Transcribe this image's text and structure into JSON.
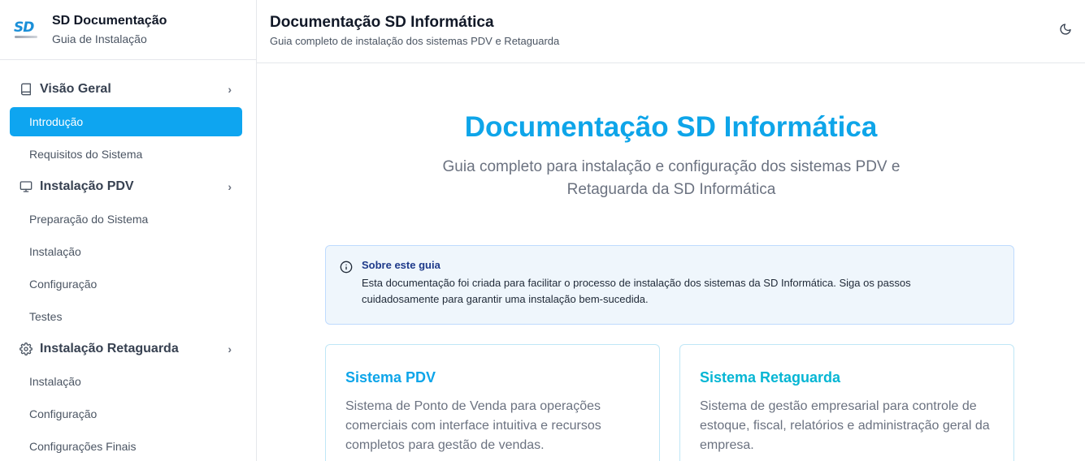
{
  "brand": {
    "logo_text": "SD",
    "title": "SD Documentação",
    "subtitle": "Guia de Instalação"
  },
  "sidebar": {
    "sections": [
      {
        "label": "Visão Geral",
        "icon": "book-icon",
        "items": [
          "Introdução",
          "Requisitos do Sistema"
        ]
      },
      {
        "label": "Instalação PDV",
        "icon": "monitor-icon",
        "items": [
          "Preparação do Sistema",
          "Instalação",
          "Configuração",
          "Testes"
        ]
      },
      {
        "label": "Instalação Retaguarda",
        "icon": "gear-icon",
        "items": [
          "Instalação",
          "Configuração",
          "Configurações Finais"
        ]
      }
    ],
    "active_item": "Introdução"
  },
  "header": {
    "title": "Documentação SD Informática",
    "subtitle": "Guia completo de instalação dos sistemas PDV e Retaguarda",
    "theme_icon": "moon-icon"
  },
  "hero": {
    "title": "Documentação SD Informática",
    "subtitle": "Guia completo para instalação e configuração dos sistemas PDV e Retaguarda da SD Informática"
  },
  "info": {
    "icon": "info-icon",
    "title": "Sobre este guia",
    "text": "Esta documentação foi criada para facilitar o processo de instalação dos sistemas da SD Informática. Siga os passos cuidadosamente para garantir uma instalação bem-sucedida."
  },
  "cards": [
    {
      "title": "Sistema PDV",
      "text": "Sistema de Ponto de Venda para operações comerciais com interface intuitiva e recursos completos para gestão de vendas.",
      "color": "#0ea5e9"
    },
    {
      "title": "Sistema Retaguarda",
      "text": "Sistema de gestão empresarial para controle de estoque, fiscal, relatórios e administração geral da empresa.",
      "color": "#06b6d4"
    }
  ],
  "colors": {
    "accent": "#0ea5f0",
    "border": "#e5e7eb"
  }
}
